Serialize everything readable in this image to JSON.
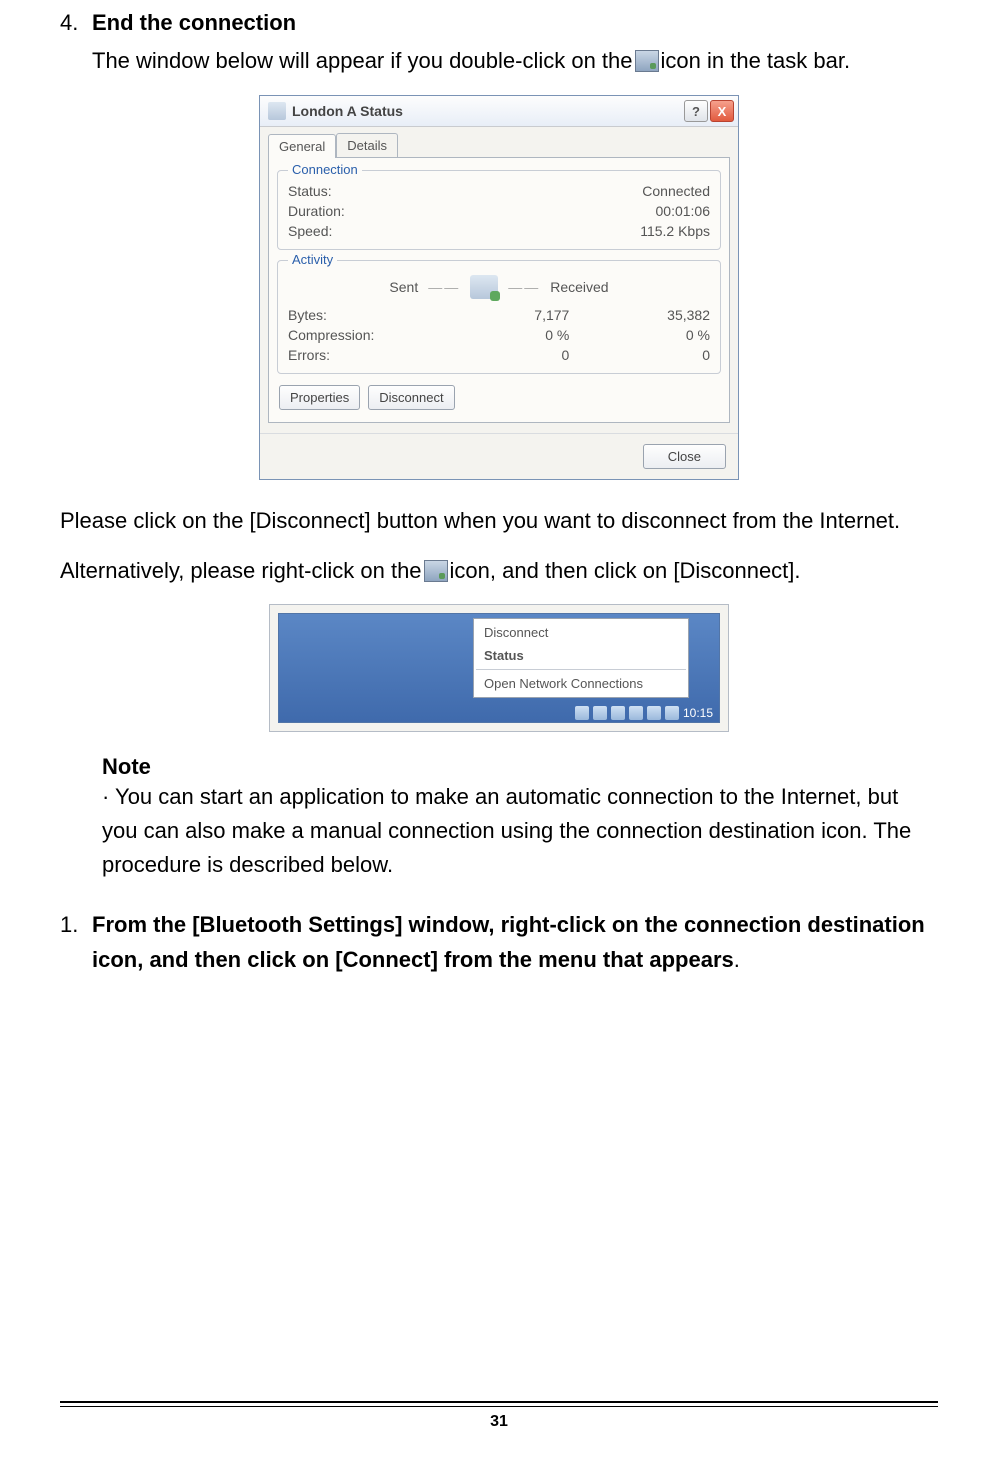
{
  "step4": {
    "num": "4.",
    "heading": "End the connection",
    "intro_pre": "The window below will appear if you double-click on the",
    "intro_post": "icon in the task bar."
  },
  "dialog": {
    "title": "London A Status",
    "help_char": "?",
    "close_char": "X",
    "tabs": {
      "general": "General",
      "details": "Details"
    },
    "connection": {
      "legend": "Connection",
      "status_label": "Status:",
      "status_value": "Connected",
      "duration_label": "Duration:",
      "duration_value": "00:01:06",
      "speed_label": "Speed:",
      "speed_value": "115.2 Kbps"
    },
    "activity": {
      "legend": "Activity",
      "sent": "Sent",
      "received": "Received",
      "bytes_label": "Bytes:",
      "bytes_sent": "7,177",
      "bytes_recv": "35,382",
      "compression_label": "Compression:",
      "compression_sent": "0 %",
      "compression_recv": "0 %",
      "errors_label": "Errors:",
      "errors_sent": "0",
      "errors_recv": "0"
    },
    "buttons": {
      "properties": "Properties",
      "disconnect": "Disconnect",
      "close": "Close"
    }
  },
  "para_disconnect": "Please click on the [Disconnect] button when you want to disconnect from the Internet.",
  "para_alt_pre": "Alternatively, please right-click on the",
  "para_alt_post": "icon, and then click on [Disconnect].",
  "context_menu": {
    "disconnect": "Disconnect",
    "status": "Status",
    "open_net": "Open Network Connections"
  },
  "tray_time": "10:15",
  "note": {
    "heading": "Note",
    "bullet": "·",
    "body": " You can start an application to make an automatic connection to the Internet, but you can also make a manual connection using the connection destination icon. The procedure is described below."
  },
  "step1b": {
    "num": "1.",
    "text": "From the [Bluetooth Settings] window, right-click on the connection destination icon, and then click on [Connect] from the menu that appears",
    "dot": "."
  },
  "page_number": "31"
}
